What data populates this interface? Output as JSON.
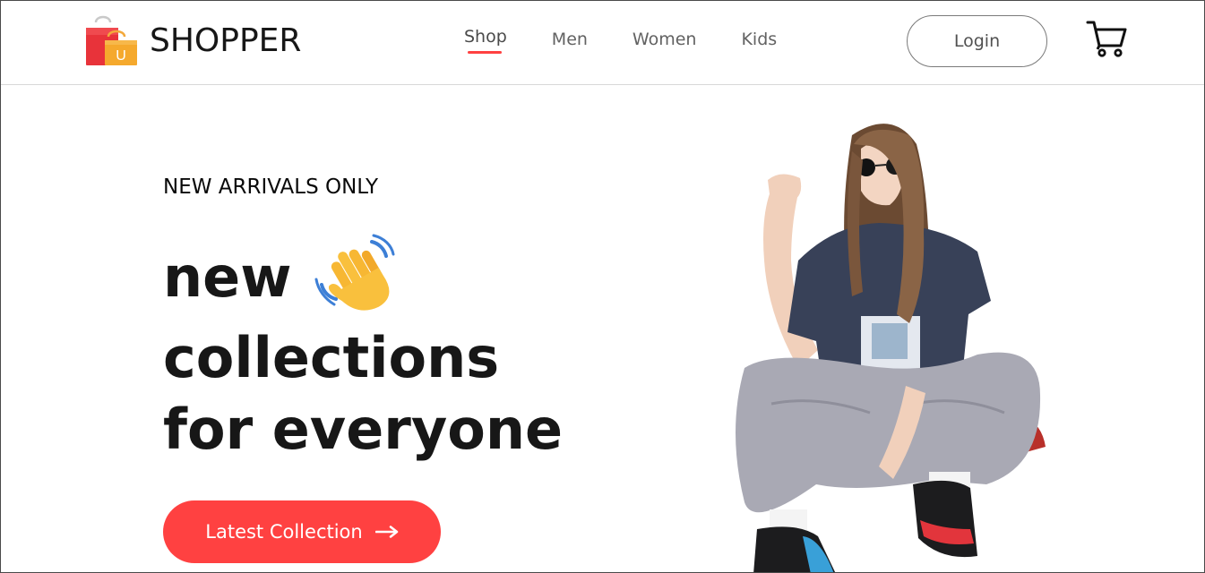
{
  "brand": {
    "name": "SHOPPER",
    "logo_badge_letter": "U"
  },
  "nav": {
    "items": [
      {
        "label": "Shop",
        "active": true
      },
      {
        "label": "Men",
        "active": false
      },
      {
        "label": "Women",
        "active": false
      },
      {
        "label": "Kids",
        "active": false
      }
    ]
  },
  "header": {
    "login_label": "Login",
    "cart_icon": "shopping-cart-icon"
  },
  "hero": {
    "kicker": "NEW ARRIVALS ONLY",
    "line1": "new",
    "line2": "collections",
    "line3": "for everyone",
    "wave_icon": "waving-hand-icon",
    "cta_label": "Latest Collection",
    "cta_icon": "arrow-right-icon"
  },
  "colors": {
    "accent": "#ff4141",
    "text_dark": "#171717",
    "nav_text": "#626262"
  }
}
